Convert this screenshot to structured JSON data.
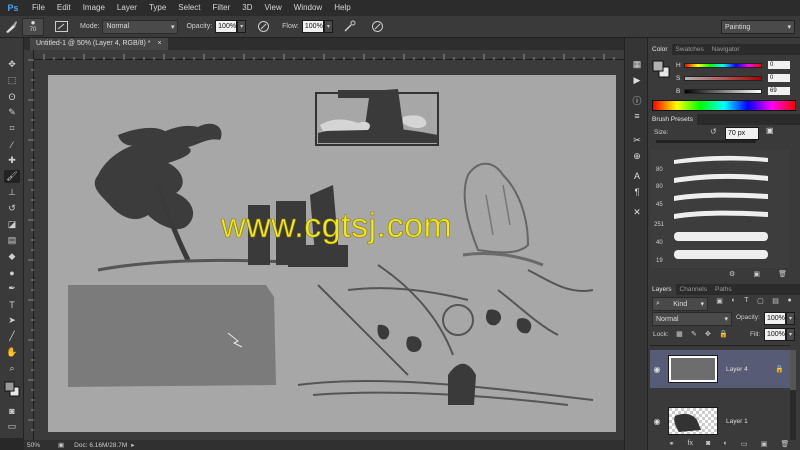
{
  "app": {
    "logo": "Ps"
  },
  "menu": [
    "File",
    "Edit",
    "Image",
    "Layer",
    "Type",
    "Select",
    "Filter",
    "3D",
    "View",
    "Window",
    "Help"
  ],
  "options": {
    "brush_size": "70",
    "mode_label": "Mode:",
    "mode_value": "Normal",
    "opacity_label": "Opacity:",
    "opacity_value": "100%",
    "flow_label": "Flow:",
    "flow_value": "100%"
  },
  "workspace": "Painting",
  "document": {
    "tab_title": "Untitled-1 @ 50% (Layer 4, RGB/8) *",
    "close_glyph": "×"
  },
  "status": {
    "zoom": "50%",
    "doc_info": "Doc: 6.16M/28.7M"
  },
  "watermark": "www.cgtsj.com",
  "color_panel": {
    "tabs": [
      "Color",
      "Swatches",
      "Navigator"
    ],
    "sliders": [
      {
        "label": "H",
        "value": "0"
      },
      {
        "label": "S",
        "value": "0"
      },
      {
        "label": "B",
        "value": "69"
      }
    ]
  },
  "brush_presets": {
    "title": "Brush Presets",
    "size_label": "Size:",
    "size_value": "70 px",
    "preset_sizes": [
      "80",
      "80",
      "45",
      "251",
      "40",
      "19"
    ]
  },
  "layers_panel": {
    "tabs": [
      "Layers",
      "Channels",
      "Paths"
    ],
    "kind_label": "Kind",
    "blend_mode": "Normal",
    "opacity_label": "Opacity:",
    "opacity_value": "100%",
    "lock_label": "Lock:",
    "fill_label": "Fill:",
    "fill_value": "100%",
    "layers": [
      {
        "name": "Layer 4",
        "selected": true
      },
      {
        "name": "Layer 1",
        "selected": false
      }
    ]
  },
  "colors": {
    "accent_selected_layer": "#575b75",
    "canvas_gray": "#a7a7a7",
    "watermark_yellow": "#f2ea18",
    "ps_blue": "#4aa3f0"
  }
}
